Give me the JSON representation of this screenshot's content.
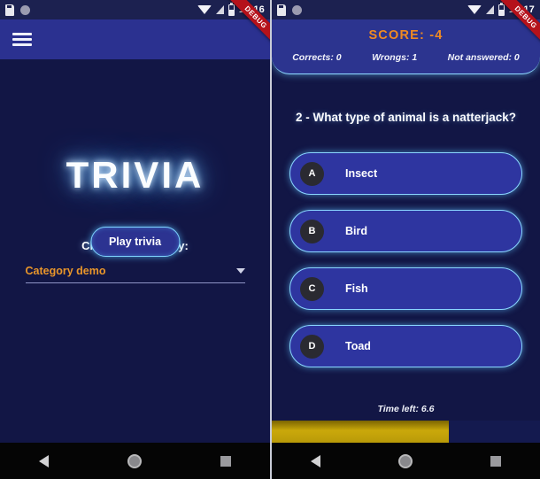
{
  "left_screen": {
    "status_bar": {
      "time": "10:16",
      "icons": [
        "sd-card-icon",
        "circle-icon",
        "wifi-icon",
        "signal-icon",
        "battery-icon"
      ]
    },
    "debug_ribbon": "DEBUG",
    "appbar": {
      "menu_icon": "hamburger-menu-icon"
    },
    "title": "TRIVIA",
    "choose_label": "Choose a category:",
    "category_dropdown": {
      "value": "Category demo",
      "caret_icon": "chevron-down-icon"
    },
    "play_button": "Play trivia",
    "nav_bar": {
      "back": "back-triangle-icon",
      "home": "home-circle-icon",
      "recents": "recents-square-icon"
    },
    "colors": {
      "background": "#121645",
      "appbar": "#2b3190",
      "accent_orange": "#e9962a",
      "glow_cyan": "#7fd4ff"
    }
  },
  "right_screen": {
    "status_bar": {
      "time": "10:17",
      "icons": [
        "sd-card-icon",
        "circle-icon",
        "wifi-icon",
        "signal-icon",
        "battery-icon"
      ]
    },
    "debug_ribbon": "DEBUG",
    "score": "SCORE: -4",
    "stats": [
      "Corrects: 0",
      "Wrongs: 1",
      "Not answered: 0"
    ],
    "question": "2 - What type of animal is a natterjack?",
    "answers": [
      {
        "letter": "A",
        "text": "Insect"
      },
      {
        "letter": "B",
        "text": "Bird"
      },
      {
        "letter": "C",
        "text": "Fish"
      },
      {
        "letter": "D",
        "text": "Toad"
      }
    ],
    "timer": {
      "label": "Time left: 6.6",
      "progress_percent": 66
    },
    "nav_bar": {
      "back": "back-triangle-icon",
      "home": "home-circle-icon",
      "recents": "recents-square-icon"
    },
    "colors": {
      "background": "#121645",
      "card": "#2c348f",
      "answer": "#2e35a0",
      "score_orange": "#ef8a22",
      "timer_fill": "#caa80b"
    }
  }
}
